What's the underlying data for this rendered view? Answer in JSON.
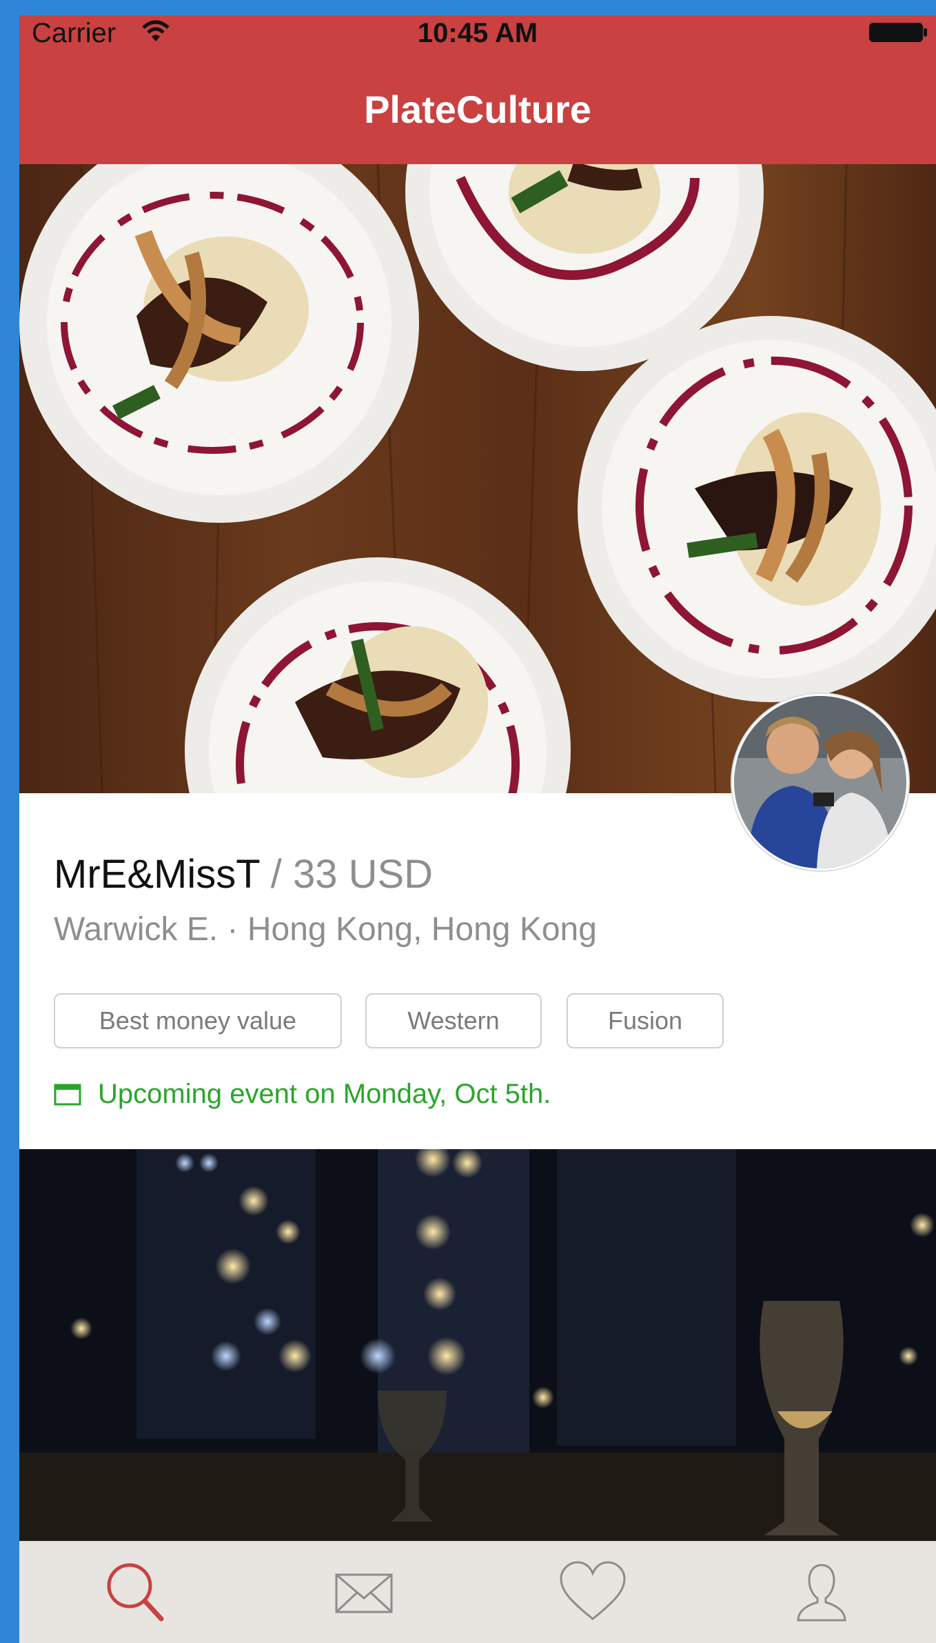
{
  "status_bar": {
    "carrier": "Carrier",
    "time": "10:45 AM"
  },
  "nav": {
    "title": "PlateCulture"
  },
  "listing": {
    "host_name": "MrE&MissT",
    "separator": " / ",
    "price": "33 USD",
    "host_first": "Warwick E.",
    "dot": " · ",
    "location": "Hong Kong, Hong Kong",
    "tags": [
      "Best money value",
      "Western",
      "Fusion"
    ],
    "event_text": "Upcoming event on Monday, Oct 5th."
  },
  "tabbar": {
    "items": [
      {
        "icon": "search-icon",
        "active": true
      },
      {
        "icon": "mail-icon",
        "active": false
      },
      {
        "icon": "heart-icon",
        "active": false
      },
      {
        "icon": "profile-icon",
        "active": false
      }
    ]
  },
  "colors": {
    "accent": "#c94141",
    "event_green": "#2aa52a",
    "tabbar_bg": "#e8e5e1",
    "inactive_icon": "#8c8c8c"
  }
}
